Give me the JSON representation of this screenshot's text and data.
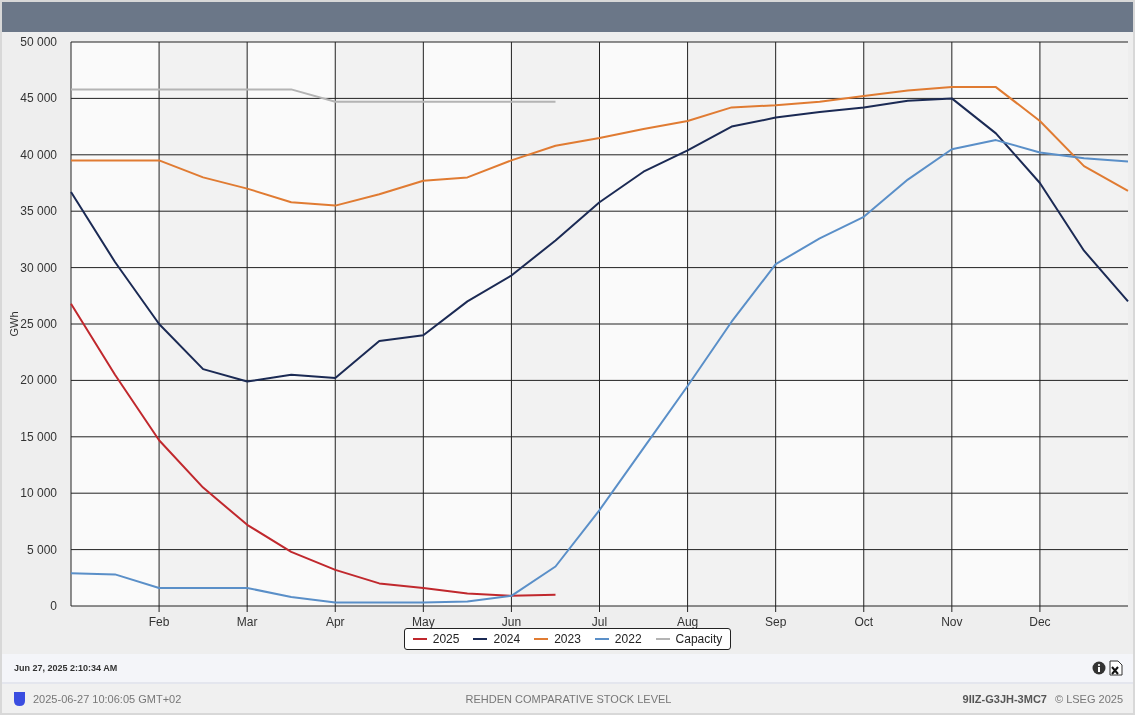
{
  "chart": {
    "chart_data": {
      "type": "line",
      "grid": true,
      "ylabel": "GWh",
      "ylim": [
        0,
        50000
      ],
      "categories": [
        null,
        null,
        "Feb",
        null,
        "Mar",
        null,
        "Apr",
        null,
        "May",
        null,
        "Jun",
        null,
        "Jul",
        null,
        "Aug",
        null,
        "Sep",
        null,
        "Oct",
        null,
        "Nov",
        null,
        "Dec",
        null,
        null
      ],
      "series": [
        {
          "name": "2025",
          "color": "#c0282d",
          "values": [
            26800,
            20500,
            14700,
            10500,
            7200,
            4800,
            3200,
            2000,
            1600,
            1100,
            900,
            1000,
            null,
            null,
            null,
            null,
            null,
            null,
            null,
            null,
            null,
            null,
            null,
            null,
            null
          ]
        },
        {
          "name": "2024",
          "color": "#1b2a54",
          "values": [
            36700,
            30500,
            25000,
            21000,
            19900,
            20500,
            20200,
            23500,
            24000,
            27000,
            29300,
            32400,
            35800,
            38500,
            40400,
            42500,
            43300,
            43800,
            44200,
            44800,
            45000,
            41900,
            37500,
            31500,
            27000
          ]
        },
        {
          "name": "2023",
          "color": "#e07b32",
          "values": [
            39500,
            39500,
            39500,
            38000,
            37000,
            35800,
            35500,
            36500,
            37700,
            38000,
            39500,
            40800,
            41500,
            42300,
            43000,
            44200,
            44400,
            44700,
            45200,
            45700,
            46000,
            46000,
            43000,
            39000,
            36800
          ]
        },
        {
          "name": "2022",
          "color": "#5a8fc8",
          "values": [
            2900,
            2800,
            1600,
            1600,
            1600,
            800,
            300,
            300,
            300,
            400,
            900,
            3500,
            8500,
            14000,
            19500,
            25200,
            30300,
            32600,
            34500,
            37800,
            40500,
            41300,
            40200,
            39700,
            39400
          ]
        },
        {
          "name": "Capacity",
          "color": "#b4b4b4",
          "values": [
            45800,
            45800,
            45800,
            45800,
            45800,
            45800,
            44700,
            44700,
            44700,
            44700,
            44700,
            44700,
            null,
            null,
            null,
            null,
            null,
            null,
            null,
            null,
            null,
            null,
            null,
            null,
            null
          ]
        }
      ],
      "yticks": [
        {
          "value": 0,
          "label": "0"
        },
        {
          "value": 5000,
          "label": "5 000"
        },
        {
          "value": 10000,
          "label": "10 000"
        },
        {
          "value": 15000,
          "label": "15 000"
        },
        {
          "value": 20000,
          "label": "20 000"
        },
        {
          "value": 25000,
          "label": "25 000"
        },
        {
          "value": 30000,
          "label": "30 000"
        },
        {
          "value": 35000,
          "label": "35 000"
        },
        {
          "value": 40000,
          "label": "40 000"
        },
        {
          "value": 45000,
          "label": "45 000"
        },
        {
          "value": 50000,
          "label": "50 000"
        }
      ]
    }
  },
  "timestamp": "Jun 27, 2025 2:10:34 AM",
  "status_bar": {
    "datetime": "2025-06-27 10:06:05 GMT+02",
    "title": "REHDEN COMPARATIVE STOCK LEVEL",
    "code": "9IIZ-G3JH-3MC7",
    "copyright": "© LSEG 2025"
  }
}
